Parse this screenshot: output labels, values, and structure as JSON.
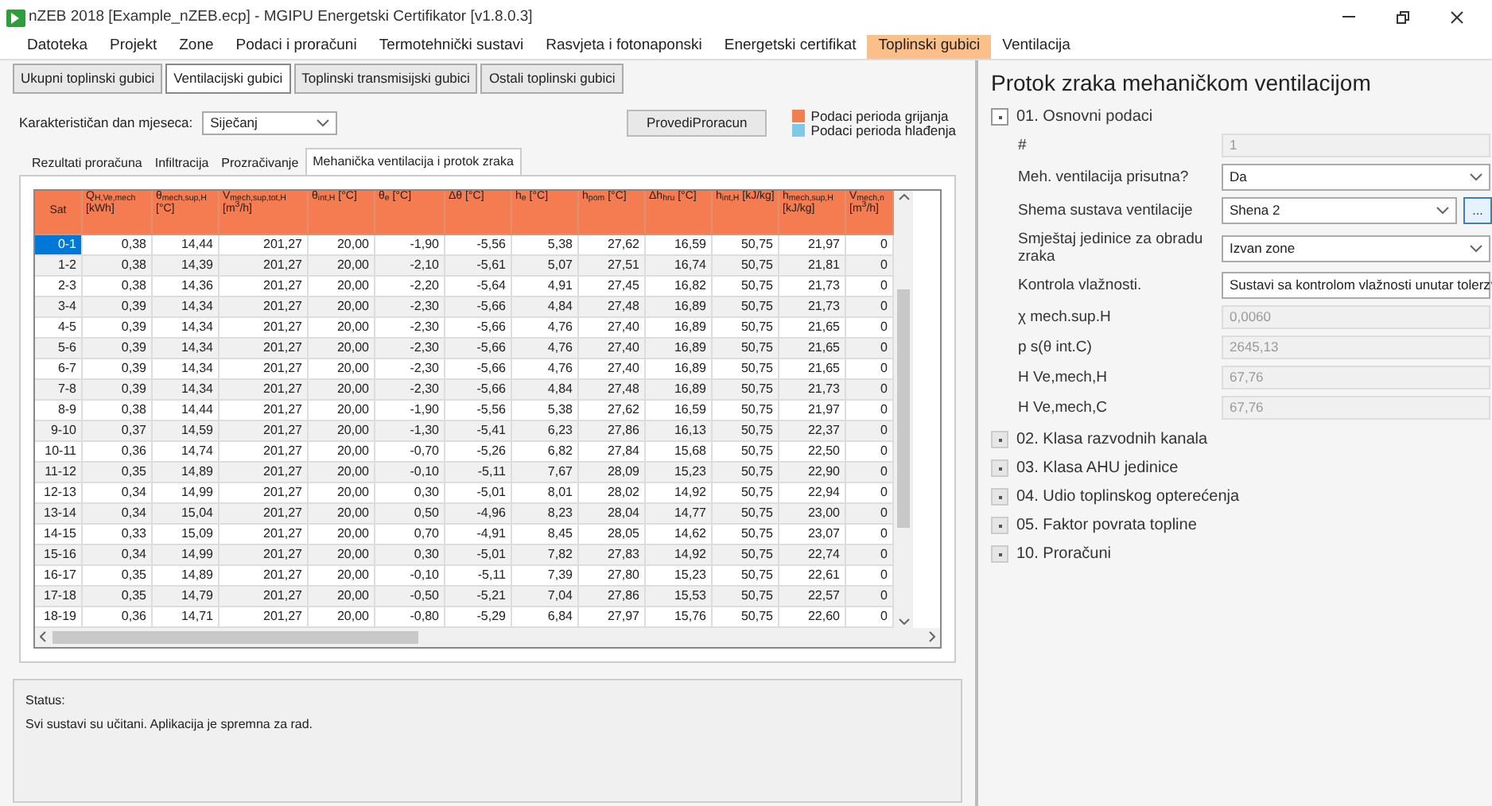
{
  "window": {
    "title": "nZEB 2018 [Example_nZEB.ecp] - MGIPU Energetski Certifikator [v1.8.0.3]"
  },
  "menu": [
    {
      "label": "Datoteka",
      "selected": false
    },
    {
      "label": "Projekt",
      "selected": false
    },
    {
      "label": "Zone",
      "selected": false
    },
    {
      "label": "Podaci i proračuni",
      "selected": false
    },
    {
      "label": "Termotehnički sustavi",
      "selected": false
    },
    {
      "label": "Rasvjeta i fotonaponski",
      "selected": false
    },
    {
      "label": "Energetski certifikat",
      "selected": false
    },
    {
      "label": "Toplinski gubici",
      "selected": true
    },
    {
      "label": "Ventilacija",
      "selected": false
    }
  ],
  "subtabs": [
    {
      "label": "Ukupni toplinski gubici",
      "selected": false
    },
    {
      "label": "Ventilacijski gubici",
      "selected": true
    },
    {
      "label": "Toplinski transmisijski gubici",
      "selected": false
    },
    {
      "label": "Ostali toplinski gubici",
      "selected": false
    }
  ],
  "day_select": {
    "label": "Karakterističan dan mjeseca:",
    "value": "Siječanj"
  },
  "run_button": "ProvediProracun",
  "legend": [
    {
      "label": "Podaci perioda grijanja",
      "color": "#f08050"
    },
    {
      "label": "Podaci perioda hlađenja",
      "color": "#7ec8e8"
    }
  ],
  "inner_tabs": [
    {
      "label": "Rezultati proračuna",
      "selected": false
    },
    {
      "label": "Infiltracija",
      "selected": false
    },
    {
      "label": "Prozračivanje",
      "selected": false
    },
    {
      "label": "Mehanička ventilacija i protok zraka",
      "selected": true
    }
  ],
  "table": {
    "columns": [
      "Sat",
      "Q$_{H,Ve,mech}$ [kWh]",
      "θ$_{mech,sup,H}$ [°C]",
      "V$_{mech,sup,tot,H}$ [m$^{3}$/h]",
      "θ$_{int,H}$ [°C]",
      "θ$_{e}$ [°C]",
      "Δθ [°C]",
      "h$_{e}$ [°C]",
      "h$_{pom}$ [°C]",
      "Δh$_{hru}$ [°C]",
      "h$_{int,H}$ [kJ/kg]",
      "h$_{mech,sup,H}$ [kJ/kg]",
      "V$_{mech,n}$ [m$^{3}$/h]"
    ],
    "rows": [
      {
        "selected": true,
        "cells": [
          "0-1",
          "0,38",
          "14,44",
          "201,27",
          "20,00",
          "-1,90",
          "-5,56",
          "5,38",
          "27,62",
          "16,59",
          "50,75",
          "21,97",
          "0"
        ]
      },
      {
        "selected": false,
        "cells": [
          "1-2",
          "0,38",
          "14,39",
          "201,27",
          "20,00",
          "-2,10",
          "-5,61",
          "5,07",
          "27,51",
          "16,74",
          "50,75",
          "21,81",
          "0"
        ]
      },
      {
        "selected": false,
        "cells": [
          "2-3",
          "0,38",
          "14,36",
          "201,27",
          "20,00",
          "-2,20",
          "-5,64",
          "4,91",
          "27,45",
          "16,82",
          "50,75",
          "21,73",
          "0"
        ]
      },
      {
        "selected": false,
        "cells": [
          "3-4",
          "0,39",
          "14,34",
          "201,27",
          "20,00",
          "-2,30",
          "-5,66",
          "4,84",
          "27,48",
          "16,89",
          "50,75",
          "21,73",
          "0"
        ]
      },
      {
        "selected": false,
        "cells": [
          "4-5",
          "0,39",
          "14,34",
          "201,27",
          "20,00",
          "-2,30",
          "-5,66",
          "4,76",
          "27,40",
          "16,89",
          "50,75",
          "21,65",
          "0"
        ]
      },
      {
        "selected": false,
        "cells": [
          "5-6",
          "0,39",
          "14,34",
          "201,27",
          "20,00",
          "-2,30",
          "-5,66",
          "4,76",
          "27,40",
          "16,89",
          "50,75",
          "21,65",
          "0"
        ]
      },
      {
        "selected": false,
        "cells": [
          "6-7",
          "0,39",
          "14,34",
          "201,27",
          "20,00",
          "-2,30",
          "-5,66",
          "4,76",
          "27,40",
          "16,89",
          "50,75",
          "21,65",
          "0"
        ]
      },
      {
        "selected": false,
        "cells": [
          "7-8",
          "0,39",
          "14,34",
          "201,27",
          "20,00",
          "-2,30",
          "-5,66",
          "4,84",
          "27,48",
          "16,89",
          "50,75",
          "21,73",
          "0"
        ]
      },
      {
        "selected": false,
        "cells": [
          "8-9",
          "0,38",
          "14,44",
          "201,27",
          "20,00",
          "-1,90",
          "-5,56",
          "5,38",
          "27,62",
          "16,59",
          "50,75",
          "21,97",
          "0"
        ]
      },
      {
        "selected": false,
        "cells": [
          "9-10",
          "0,37",
          "14,59",
          "201,27",
          "20,00",
          "-1,30",
          "-5,41",
          "6,23",
          "27,86",
          "16,13",
          "50,75",
          "22,37",
          "0"
        ]
      },
      {
        "selected": false,
        "cells": [
          "10-11",
          "0,36",
          "14,74",
          "201,27",
          "20,00",
          "-0,70",
          "-5,26",
          "6,82",
          "27,84",
          "15,68",
          "50,75",
          "22,50",
          "0"
        ]
      },
      {
        "selected": false,
        "cells": [
          "11-12",
          "0,35",
          "14,89",
          "201,27",
          "20,00",
          "-0,10",
          "-5,11",
          "7,67",
          "28,09",
          "15,23",
          "50,75",
          "22,90",
          "0"
        ]
      },
      {
        "selected": false,
        "cells": [
          "12-13",
          "0,34",
          "14,99",
          "201,27",
          "20,00",
          "0,30",
          "-5,01",
          "8,01",
          "28,02",
          "14,92",
          "50,75",
          "22,94",
          "0"
        ]
      },
      {
        "selected": false,
        "cells": [
          "13-14",
          "0,34",
          "15,04",
          "201,27",
          "20,00",
          "0,50",
          "-4,96",
          "8,23",
          "28,04",
          "14,77",
          "50,75",
          "23,00",
          "0"
        ]
      },
      {
        "selected": false,
        "cells": [
          "14-15",
          "0,33",
          "15,09",
          "201,27",
          "20,00",
          "0,70",
          "-4,91",
          "8,45",
          "28,05",
          "14,62",
          "50,75",
          "23,07",
          "0"
        ]
      },
      {
        "selected": false,
        "cells": [
          "15-16",
          "0,34",
          "14,99",
          "201,27",
          "20,00",
          "0,30",
          "-5,01",
          "7,82",
          "27,83",
          "14,92",
          "50,75",
          "22,74",
          "0"
        ]
      },
      {
        "selected": false,
        "cells": [
          "16-17",
          "0,35",
          "14,89",
          "201,27",
          "20,00",
          "-0,10",
          "-5,11",
          "7,39",
          "27,80",
          "15,23",
          "50,75",
          "22,61",
          "0"
        ]
      },
      {
        "selected": false,
        "cells": [
          "17-18",
          "0,35",
          "14,79",
          "201,27",
          "20,00",
          "-0,50",
          "-5,21",
          "7,04",
          "27,86",
          "15,53",
          "50,75",
          "22,57",
          "0"
        ]
      },
      {
        "selected": false,
        "cells": [
          "18-19",
          "0,36",
          "14,71",
          "201,27",
          "20,00",
          "-0,80",
          "-5,29",
          "6,84",
          "27,97",
          "15,76",
          "50,75",
          "22,60",
          "0"
        ]
      }
    ]
  },
  "status": {
    "label": "Status:",
    "message": "Svi sustavi su učitani. Aplikacija je spremna za rad."
  },
  "panel": {
    "title": "Protok zraka mehaničkom ventilacijom",
    "sections": [
      {
        "label": "01. Osnovni podaci",
        "expanded": true,
        "fields": [
          {
            "kind": "readonly",
            "label": "#",
            "value": "1"
          },
          {
            "kind": "select",
            "label": "Meh. ventilacija prisutna?",
            "value": "Da"
          },
          {
            "kind": "select_button",
            "label": "Shema sustava ventilacije",
            "value": "Shena 2",
            "button": "..."
          },
          {
            "kind": "select",
            "label": "Smještaj jedinice za obradu zraka",
            "value": "Izvan zone"
          },
          {
            "kind": "select",
            "label": "Kontrola vlažnosti.",
            "value": "Sustavi sa kontrolom vlažnosti unutar tolerz"
          },
          {
            "kind": "readonly",
            "label": "χ mech.sup.H",
            "value": "0,0060"
          },
          {
            "kind": "readonly",
            "label": "p s(θ int.C)",
            "value": "2645,13"
          },
          {
            "kind": "readonly",
            "label": "H Ve,mech,H",
            "value": "67,76"
          },
          {
            "kind": "readonly",
            "label": "H Ve,mech,C",
            "value": "67,76"
          }
        ]
      },
      {
        "label": "02. Klasa razvodnih kanala",
        "expanded": false
      },
      {
        "label": "03. Klasa AHU jedinice",
        "expanded": false
      },
      {
        "label": "04. Udio toplinskog opterećenja",
        "expanded": false
      },
      {
        "label": "05. Faktor povrata topline",
        "expanded": false
      },
      {
        "label": "10. Proračuni",
        "expanded": false
      }
    ]
  }
}
